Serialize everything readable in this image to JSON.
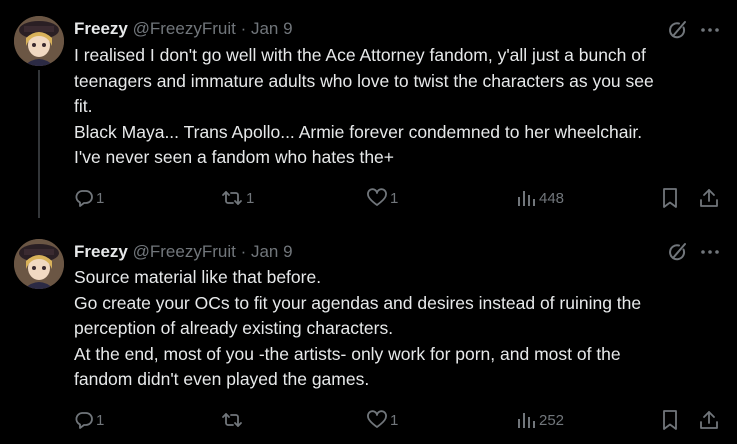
{
  "colors": {
    "background": "#000000",
    "primary_text": "#e7e9ea",
    "secondary_text": "#71767b",
    "thread_line": "#333639"
  },
  "tweets": [
    {
      "author_name": "Freezy",
      "handle": "@FreezyFruit",
      "separator": "·",
      "date": "Jan 9",
      "lines": [
        "I realised I don't go well with the Ace Attorney fandom, y'all just a bunch of",
        "teenagers and immature adults who love to twist the characters as you see",
        "fit.",
        "Black Maya... Trans Apollo... Armie forever condemned to her wheelchair.",
        "I've never seen a fandom who hates the+"
      ],
      "replies": "1",
      "reposts": "1",
      "likes": "1",
      "views": "448"
    },
    {
      "author_name": "Freezy",
      "handle": "@FreezyFruit",
      "separator": "·",
      "date": "Jan 9",
      "lines": [
        "Source material like that before.",
        "Go create your OCs to fit your agendas and desires instead of ruining the",
        "perception of already existing characters.",
        "At the end, most of you -the artists- only work for porn, and most of the",
        "fandom didn't even played the games."
      ],
      "replies": "1",
      "reposts": "",
      "likes": "1",
      "views": "252"
    }
  ],
  "icons": {
    "grok": "grok-icon",
    "more": "more-dots-icon",
    "reply": "reply-icon",
    "repost": "repost-icon",
    "like": "heart-icon",
    "views": "views-icon",
    "bookmark": "bookmark-icon",
    "share": "share-icon"
  }
}
